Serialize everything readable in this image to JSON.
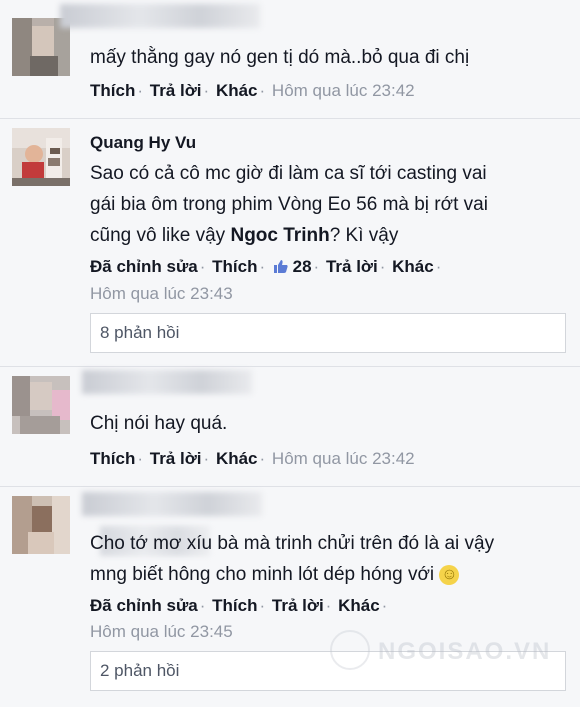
{
  "comments": [
    {
      "text_lines": [
        "mấy thằng gay nó gen tị dó mà..bỏ qua đi chị"
      ],
      "actions": [
        "Thích",
        "Trả lời",
        "Khác"
      ],
      "timestamp": "Hôm qua lúc 23:42"
    },
    {
      "name": "Quang Hy Vu",
      "text_lines": [
        "Sao có cả cô mc giờ đi làm ca sĩ tới casting vai",
        "gái bia ôm trong phim Vòng Eo 56 mà bị rớt vai"
      ],
      "text_line3_prefix": "cũng vô like vậy ",
      "text_line3_bold": "Ngoc Trinh",
      "text_line3_suffix": "? Kì vậy",
      "actions": [
        "Đã chỉnh sửa",
        "Thích"
      ],
      "like_count": "28",
      "actions_after": [
        "Trả lời",
        "Khác"
      ],
      "timestamp": "Hôm qua lúc 23:43",
      "replies": "8 phản hồi"
    },
    {
      "text_lines": [
        "Chị nói hay quá."
      ],
      "actions": [
        "Thích",
        "Trả lời",
        "Khác"
      ],
      "timestamp": "Hôm qua lúc 23:42"
    },
    {
      "text_lines": [
        "Cho tớ mơ xíu bà mà trinh chửi trên đó là ai vậy",
        "mng biết hông cho minh lót dép hóng với"
      ],
      "emoji": "☺",
      "actions": [
        "Đã chỉnh sửa",
        "Thích",
        "Trả lời",
        "Khác"
      ],
      "timestamp": "Hôm qua lúc 23:45",
      "replies": "2 phản hồi"
    }
  ],
  "watermark": "NGOISAO.VN",
  "colors": {
    "background": "#f6f7f9",
    "meta": "#9197a3",
    "like_blue": "#5b7bd5"
  }
}
